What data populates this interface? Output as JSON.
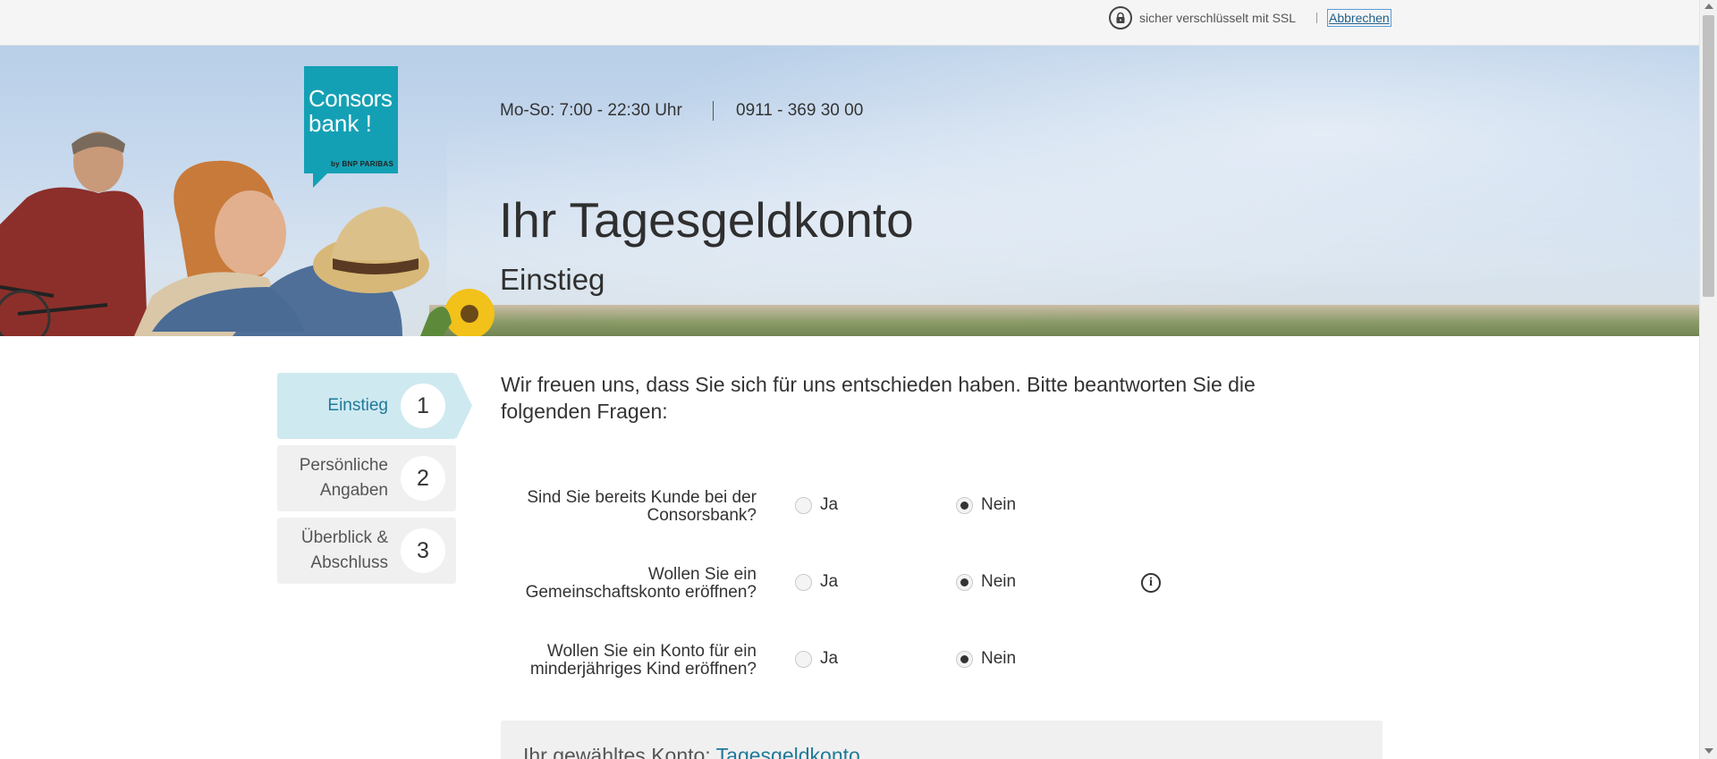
{
  "topbar": {
    "ssl_text": "sicher verschlüsselt mit SSL",
    "cancel_label": "Abbrechen",
    "lock_icon": "lock-icon"
  },
  "hero": {
    "logo_line1": "Consors",
    "logo_line2": "bank !",
    "logo_sub": "by BNP PARIBAS",
    "hours": "Mo-So: 7:00 - 22:30 Uhr",
    "phone": "0911 - 369 30 00",
    "title": "Ihr Tagesgeldkonto",
    "subtitle": "Einstieg"
  },
  "steps": [
    {
      "label": "Einstieg",
      "number": "1",
      "active": true
    },
    {
      "label_line1": "Persönliche",
      "label_line2": "Angaben",
      "number": "2",
      "active": false
    },
    {
      "label_line1": "Überblick &",
      "label_line2": "Abschluss",
      "number": "3",
      "active": false
    }
  ],
  "intro": "Wir freuen uns, dass Sie sich für uns entschieden haben. Bitte beantworten Sie die folgenden Fragen:",
  "questions": [
    {
      "line1": "Sind Sie bereits Kunde bei der",
      "line2": "Consorsbank?",
      "yes": "Ja",
      "no": "Nein",
      "selected": "no"
    },
    {
      "line1": "Wollen Sie ein",
      "line2": "Gemeinschaftskonto eröffnen?",
      "yes": "Ja",
      "no": "Nein",
      "selected": "no",
      "info_icon": "info-icon"
    },
    {
      "line1": "Wollen Sie ein Konto für ein",
      "line2": "minderjähriges Kind eröffnen?",
      "yes": "Ja",
      "no": "Nein",
      "selected": "no"
    }
  ],
  "summary": {
    "prefix": "Ihr gewähltes Konto:",
    "account": "Tagesgeldkonto"
  },
  "colors": {
    "brand": "#14a0b4",
    "active_step": "#cfe9f0",
    "link": "#1f7a99"
  }
}
